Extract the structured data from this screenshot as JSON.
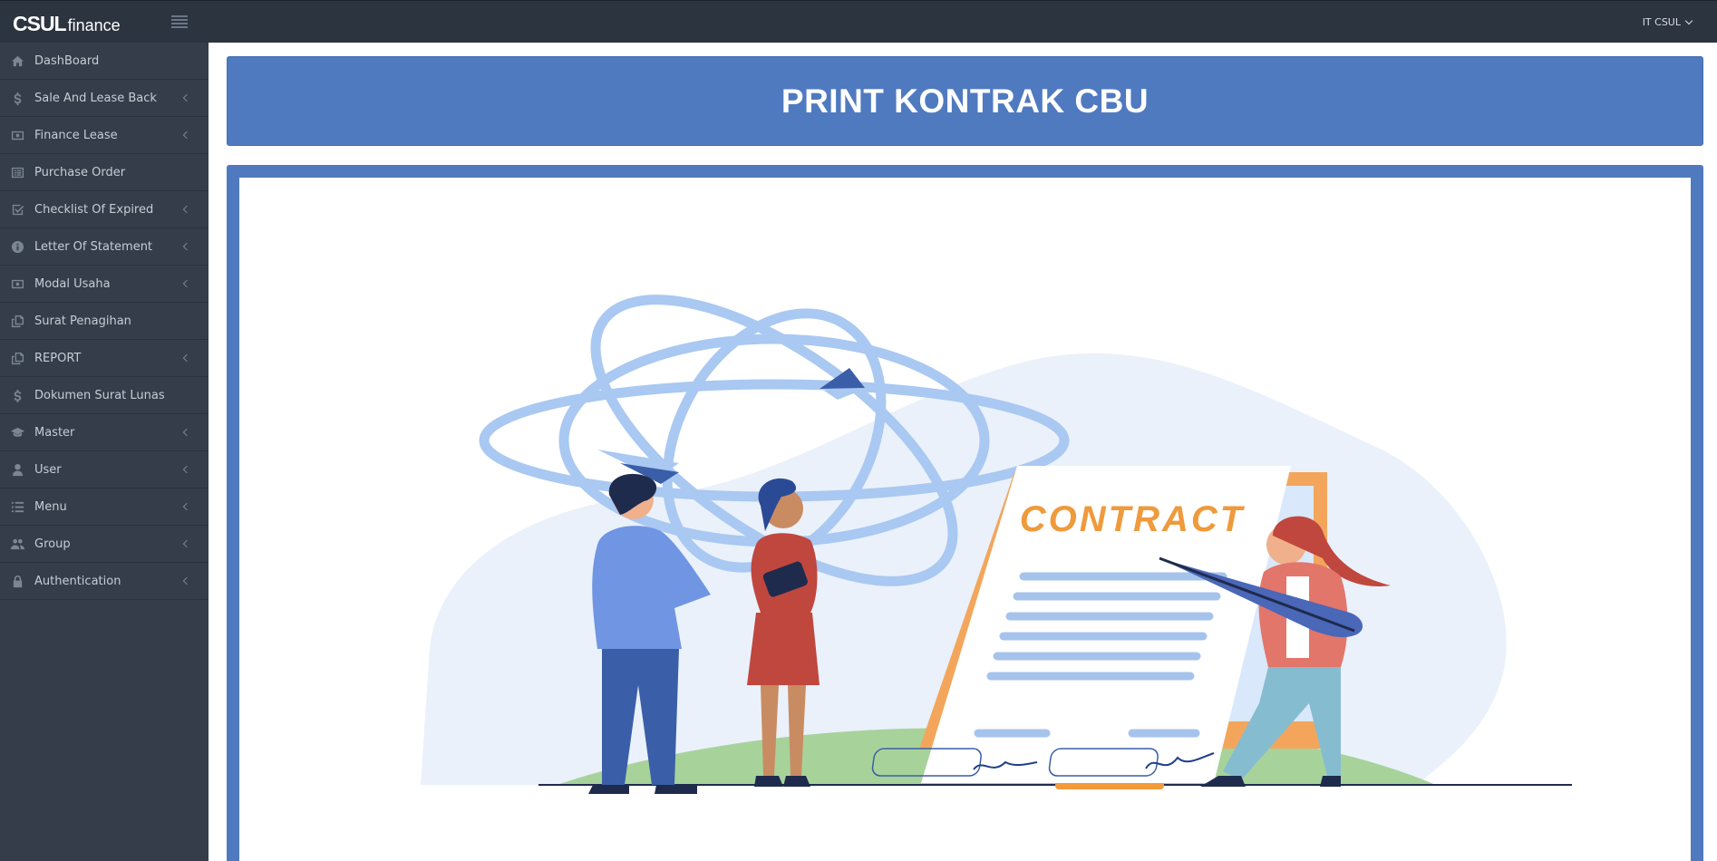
{
  "app": {
    "brand_main": "CSUL",
    "brand_sub": "finance",
    "user_label": "IT CSUL"
  },
  "sidebar": {
    "items": [
      {
        "label": "DashBoard",
        "icon": "home-icon",
        "has_submenu": false
      },
      {
        "label": "Sale And Lease Back",
        "icon": "dollar-icon",
        "has_submenu": true
      },
      {
        "label": "Finance Lease",
        "icon": "money-icon",
        "has_submenu": true
      },
      {
        "label": "Purchase Order",
        "icon": "list-alt-icon",
        "has_submenu": false
      },
      {
        "label": "Checklist Of Expired",
        "icon": "check-square-icon",
        "has_submenu": true
      },
      {
        "label": "Letter Of Statement",
        "icon": "info-circle-icon",
        "has_submenu": true
      },
      {
        "label": "Modal Usaha",
        "icon": "money-icon",
        "has_submenu": true
      },
      {
        "label": "Surat Penagihan",
        "icon": "copy-icon",
        "has_submenu": false
      },
      {
        "label": "REPORT",
        "icon": "copy-icon",
        "has_submenu": true
      },
      {
        "label": "Dokumen Surat Lunas",
        "icon": "dollar-icon",
        "has_submenu": false
      },
      {
        "label": "Master",
        "icon": "graduation-cap-icon",
        "has_submenu": true
      },
      {
        "label": "User",
        "icon": "user-icon",
        "has_submenu": true
      },
      {
        "label": "Menu",
        "icon": "list-icon",
        "has_submenu": true
      },
      {
        "label": "Group",
        "icon": "users-icon",
        "has_submenu": true
      },
      {
        "label": "Authentication",
        "icon": "lock-icon",
        "has_submenu": true
      }
    ]
  },
  "main": {
    "title": "PRINT KONTRAK CBU",
    "illustration": {
      "heading": "CONTRACT",
      "colors": {
        "frame": "#4f7ac0",
        "contract_text": "#ef9a3c",
        "lines": "#a6c3ec"
      }
    }
  }
}
